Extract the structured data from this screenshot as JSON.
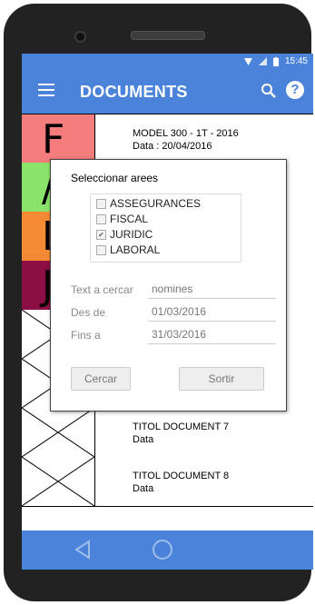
{
  "status": {
    "time": "15:45"
  },
  "appbar": {
    "title": "DOCUMENTS",
    "menu_icon": "hamburger-icon",
    "search_icon": "search-icon",
    "help_icon": "help-icon",
    "help_glyph": "?"
  },
  "documents": [
    {
      "thumb": "letter",
      "letter": "F",
      "color": "#f47c7c",
      "title": "MODEL 300 - 1T - 2016",
      "subtitle": "Data : 20/04/2016"
    },
    {
      "thumb": "letter",
      "letter": "/",
      "color": "#8ae36a",
      "title": "",
      "subtitle": ""
    },
    {
      "thumb": "letter",
      "letter": "L",
      "color": "#f48b34",
      "title": "",
      "subtitle": ""
    },
    {
      "thumb": "letter",
      "letter": "J",
      "color": "#8b0e45",
      "title": "",
      "subtitle": ""
    },
    {
      "thumb": "placeholder",
      "title": "",
      "subtitle": ""
    },
    {
      "thumb": "placeholder",
      "title": "",
      "subtitle": ""
    },
    {
      "thumb": "placeholder",
      "title": "TITOL DOCUMENT 7",
      "subtitle": "Data"
    },
    {
      "thumb": "placeholder",
      "title": "TITOL DOCUMENT 8",
      "subtitle": "Data"
    }
  ],
  "dialog": {
    "title": "Seleccionar arees",
    "areas": [
      {
        "label": "ASSEGURANCES",
        "checked": false
      },
      {
        "label": "FISCAL",
        "checked": false
      },
      {
        "label": "JURIDIC",
        "checked": true
      },
      {
        "label": "LABORAL",
        "checked": false
      }
    ],
    "fields": {
      "text_label": "Text a cercar",
      "text_value": "nomines",
      "from_label": "Des de",
      "from_value": "01/03/2016",
      "to_label": "Fins a",
      "to_value": "31/03/2016"
    },
    "search_button": "Cercar",
    "exit_button": "Sortir"
  },
  "colors": {
    "primary": "#4a83d9"
  }
}
